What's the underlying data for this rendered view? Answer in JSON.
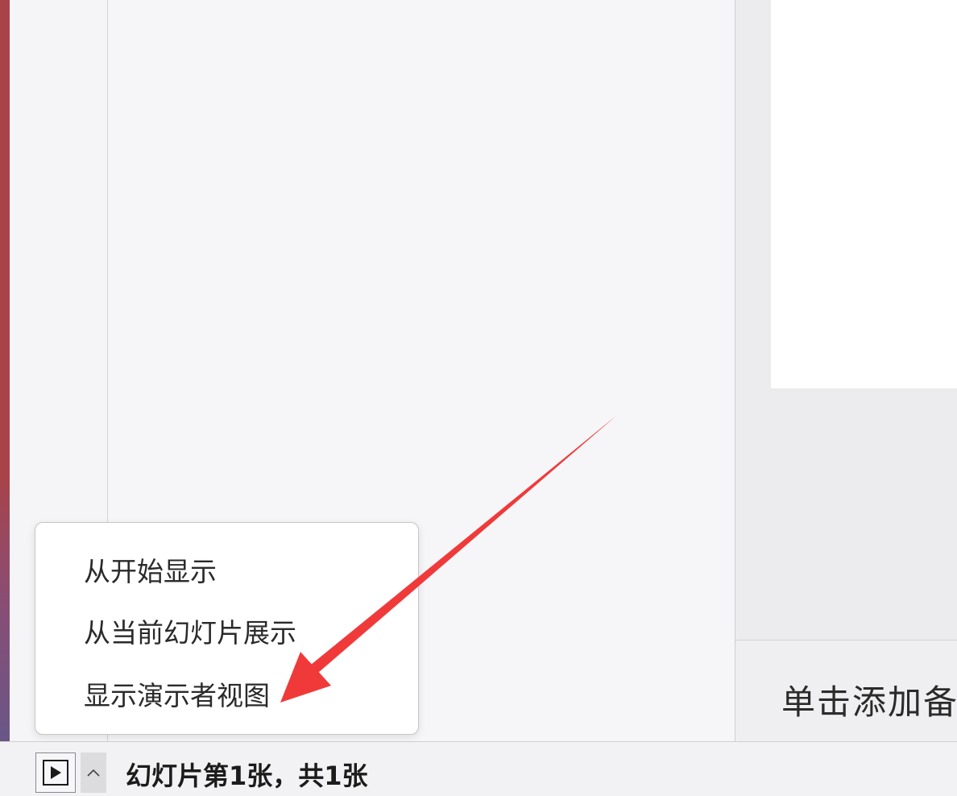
{
  "slideshow_menu": {
    "items": [
      {
        "label": "从开始显示"
      },
      {
        "label": "从当前幻灯片展示"
      },
      {
        "label": "显示演示者视图"
      }
    ]
  },
  "notes": {
    "placeholder": "单击添加备"
  },
  "status_bar": {
    "slide_counter": "幻灯片第1张，共1张"
  },
  "colors": {
    "arrow": "#f03a3a",
    "left_stripe_top": "#a8434a",
    "left_stripe_bottom": "#5c5a8f"
  },
  "icons": {
    "play": "play-icon",
    "chevron": "chevron-up-icon",
    "arrow": "annotation-arrow"
  }
}
